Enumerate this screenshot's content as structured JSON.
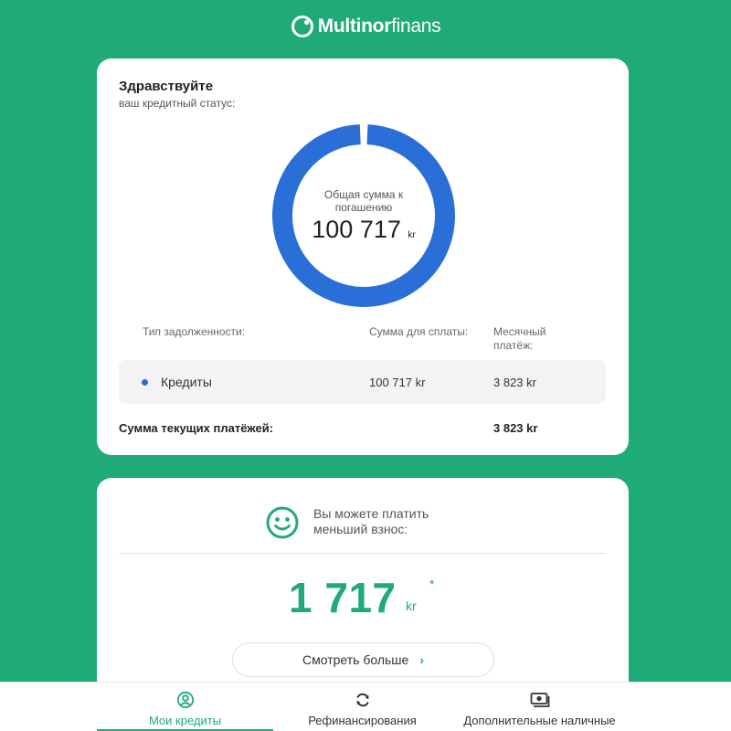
{
  "brand": {
    "name_bold": "Multinor",
    "name_light": "finans"
  },
  "status_card": {
    "greeting": "Здравствуйте",
    "subtitle": "ваш кредитный статус:",
    "donut": {
      "label": "Общая сумма к погашению",
      "value": "100 717",
      "currency": "kr",
      "fraction": 1.0,
      "color": "#2a6ed8"
    },
    "table": {
      "headers": [
        "Тип задолженности:",
        "Сумма для сплаты:",
        "Месячный платёж:"
      ],
      "rows": [
        {
          "type": "Кредиты",
          "amount": "100 717 kr",
          "monthly": "3 823 kr",
          "dot_color": "#2a6ed8"
        }
      ]
    },
    "total_label": "Сумма текущих платёжей:",
    "total_value": "3 823 kr"
  },
  "offer_card": {
    "icon": "smiley-icon",
    "message": "Вы можете платить меньший взнос:",
    "amount": "1 717",
    "currency": "kr",
    "footnote_mark": "*",
    "button_label": "Смотреть больше"
  },
  "nav": {
    "items": [
      {
        "label": "Мои кредиты",
        "icon": "user-circle-icon",
        "active": true
      },
      {
        "label": "Рефинансирования",
        "icon": "refresh-icon",
        "active": false
      },
      {
        "label": "Дополнительные наличные",
        "icon": "cash-icon",
        "active": false
      }
    ]
  },
  "colors": {
    "brand_green": "#1fab77",
    "donut_blue": "#2a6ed8"
  }
}
